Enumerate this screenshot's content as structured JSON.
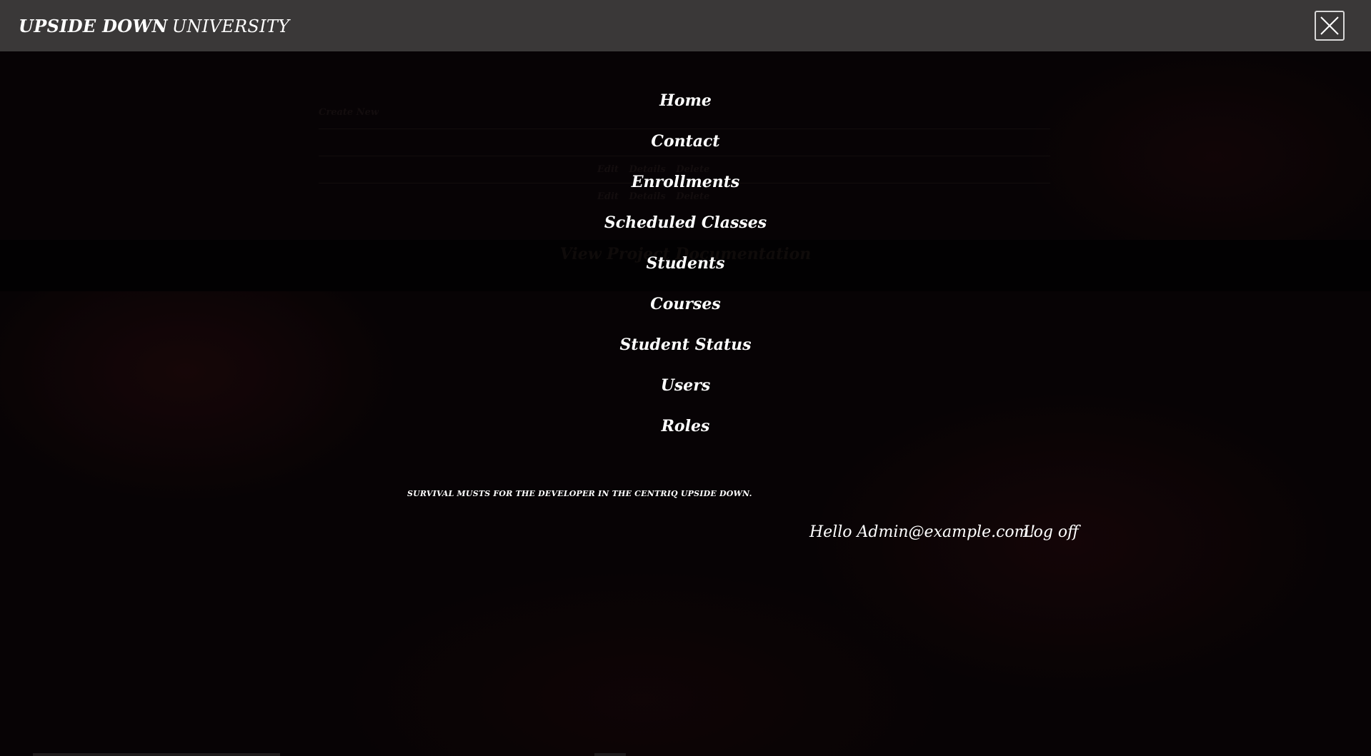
{
  "brand": {
    "bold": "UPSIDE DOWN",
    "regular": "UNIVERSITY"
  },
  "close_button": {
    "icon": "close-icon"
  },
  "menu": {
    "items": [
      {
        "label": "Home"
      },
      {
        "label": "Contact"
      },
      {
        "label": "Enrollments"
      },
      {
        "label": "Scheduled Classes"
      },
      {
        "label": "Students"
      },
      {
        "label": "Courses"
      },
      {
        "label": "Student Status"
      },
      {
        "label": "Users"
      },
      {
        "label": "Roles"
      }
    ]
  },
  "tagline": "SURVIVAL MUSTS FOR THE DEVELOPER IN THE CENTRIQ UPSIDE DOWN.",
  "account": {
    "greeting": "Hello Admin@example.com!",
    "logoff": "Log off"
  },
  "background_page": {
    "create_link": "Create New",
    "row_actions": [
      "Edit",
      "Details",
      "Delete"
    ],
    "doc_link": "View Project Documentation"
  }
}
